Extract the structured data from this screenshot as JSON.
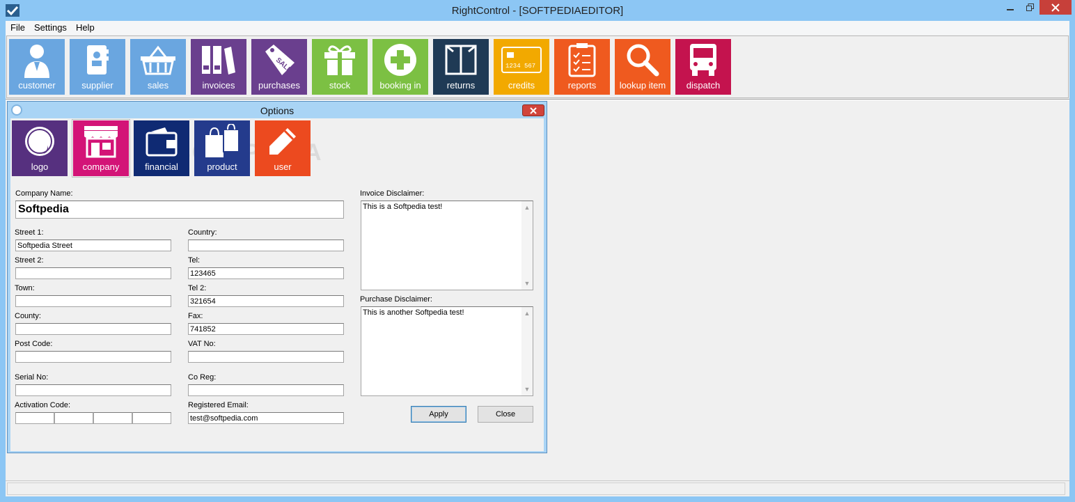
{
  "window": {
    "title": "RightControl - [SOFTPEDIAEDITOR]"
  },
  "menu": {
    "items": [
      "File",
      "Settings",
      "Help"
    ]
  },
  "toolbar": {
    "tiles": [
      {
        "label": "customer",
        "color": "#6aa6e0",
        "icon": "customer-icon"
      },
      {
        "label": "supplier",
        "color": "#6aa6e0",
        "icon": "supplier-icon"
      },
      {
        "label": "sales",
        "color": "#6aa6e0",
        "icon": "basket-icon"
      },
      {
        "label": "invoices",
        "color": "#6a3f8e",
        "icon": "binders-icon"
      },
      {
        "label": "purchases",
        "color": "#6a3f8e",
        "icon": "sale-tag-icon"
      },
      {
        "label": "stock",
        "color": "#7cc043",
        "icon": "gift-icon"
      },
      {
        "label": "booking in",
        "color": "#7cc043",
        "icon": "plus-circle-icon"
      },
      {
        "label": "returns",
        "color": "#1f3a55",
        "icon": "box-icon"
      },
      {
        "label": "credits",
        "color": "#f2a900",
        "icon": "credit-card-icon"
      },
      {
        "label": "reports",
        "color": "#ef5a1f",
        "icon": "clipboard-icon"
      },
      {
        "label": "lookup item",
        "color": "#ef5a1f",
        "icon": "magnifier-icon"
      },
      {
        "label": "dispatch",
        "color": "#c4134e",
        "icon": "truck-icon"
      }
    ]
  },
  "dialog": {
    "title": "Options",
    "tabs": [
      {
        "label": "logo",
        "color": "#56307f",
        "icon": "sticker-icon"
      },
      {
        "label": "company",
        "color": "#d31477",
        "icon": "shop-icon"
      },
      {
        "label": "financial",
        "color": "#0f2a73",
        "icon": "wallet-icon"
      },
      {
        "label": "product",
        "color": "#243b8c",
        "icon": "shopping-bags-icon"
      },
      {
        "label": "user",
        "color": "#ec4a1f",
        "icon": "pencil-icon"
      }
    ],
    "watermark": "SOFTPEDIA",
    "fields": {
      "company_name": {
        "label": "Company Name:",
        "value": "Softpedia"
      },
      "street1": {
        "label": "Street 1:",
        "value": "Softpedia Street"
      },
      "street2": {
        "label": "Street 2:",
        "value": ""
      },
      "town": {
        "label": "Town:",
        "value": ""
      },
      "county": {
        "label": "County:",
        "value": ""
      },
      "post_code": {
        "label": "Post Code:",
        "value": ""
      },
      "serial_no": {
        "label": "Serial No:",
        "value": ""
      },
      "activation_code": {
        "label": "Activation Code:",
        "value": ""
      },
      "country": {
        "label": "Country:",
        "value": ""
      },
      "tel": {
        "label": "Tel:",
        "value": "123465"
      },
      "tel2": {
        "label": "Tel 2:",
        "value": "321654"
      },
      "fax": {
        "label": "Fax:",
        "value": "741852"
      },
      "vat_no": {
        "label": "VAT No:",
        "value": ""
      },
      "co_reg": {
        "label": "Co Reg:",
        "value": ""
      },
      "registered_email": {
        "label": "Registered Email:",
        "value": "test@softpedia.com"
      }
    },
    "invoice_disclaimer": {
      "label": "Invoice Disclaimer:",
      "value": "This is a Softpedia test!"
    },
    "purchase_disclaimer": {
      "label": "Purchase Disclaimer:",
      "value": "This is another Softpedia test!"
    },
    "apply_label": "Apply",
    "close_label": "Close"
  }
}
